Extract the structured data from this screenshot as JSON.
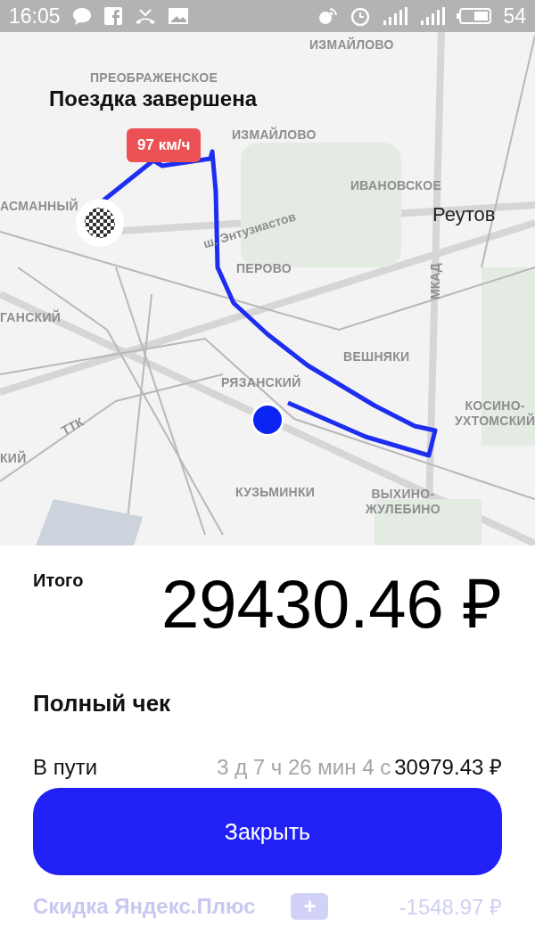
{
  "status_bar": {
    "time": "16:05",
    "battery": "54"
  },
  "map": {
    "title": "Поездка завершена",
    "speed_badge": "97 км/ч",
    "labels": [
      {
        "text": "ИЗМАЙЛОВО",
        "kind": "district"
      },
      {
        "text": "ПРЕОБРАЖЕНСКОЕ",
        "kind": "district"
      },
      {
        "text": "ИЗМАЙЛОВО",
        "kind": "district"
      },
      {
        "text": "ИВАНОВСКОЕ",
        "kind": "district"
      },
      {
        "text": "АСМАННЫЙ",
        "kind": "district"
      },
      {
        "text": "Реутов",
        "kind": "city"
      },
      {
        "text": "ш. Энтузиастов",
        "kind": "road"
      },
      {
        "text": "ПЕРОВО",
        "kind": "district"
      },
      {
        "text": "МКАД",
        "kind": "road"
      },
      {
        "text": "ГАНСКИЙ",
        "kind": "district"
      },
      {
        "text": "ВЕШНЯКИ",
        "kind": "district"
      },
      {
        "text": "РЯЗАНСКИЙ",
        "kind": "district"
      },
      {
        "text": "ТТК",
        "kind": "road"
      },
      {
        "text": "КОСИНО-\nУХТОМСКИЙ",
        "kind": "district"
      },
      {
        "text": "КИЙ",
        "kind": "district"
      },
      {
        "text": "КУЗЬМИНКИ",
        "kind": "district"
      },
      {
        "text": "ВЫХИНО-\nЖУЛЕБИНО",
        "kind": "district"
      }
    ]
  },
  "sheet": {
    "total_label": "Итого",
    "total": "29430.46 ₽",
    "receipt_title": "Полный чек",
    "lines": [
      {
        "label": "В пути",
        "detail": "3 д 7 ч 26 мин 4 с",
        "amount": "30979.43 ₽"
      }
    ],
    "close_button": "Закрыть",
    "discount": {
      "label": "Скидка Яндекс.Плюс",
      "badge": "+",
      "amount": "-1548.97 ₽"
    }
  }
}
